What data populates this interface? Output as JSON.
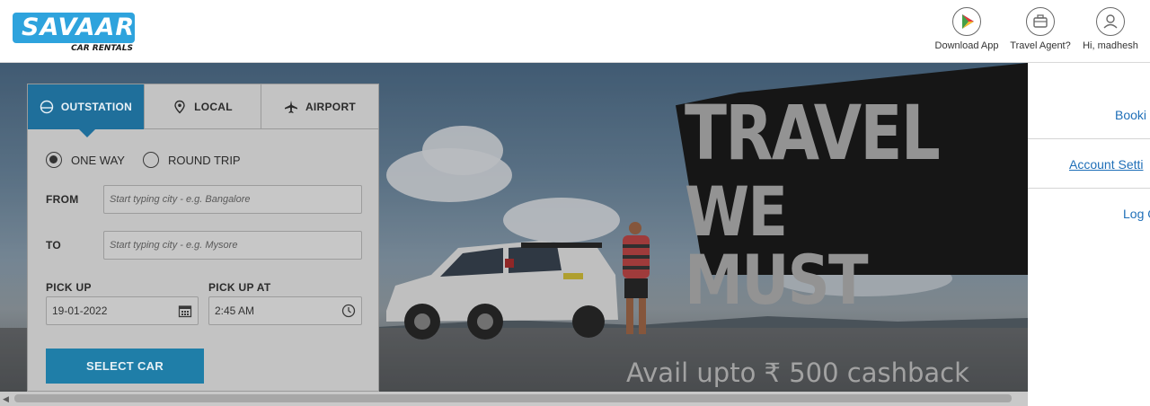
{
  "brand": {
    "name": "SAVAARI",
    "tagline": "CAR RENTALS"
  },
  "header_actions": [
    {
      "label": "Download App",
      "icon": "play-store-icon"
    },
    {
      "label": "Travel Agent?",
      "icon": "briefcase-icon"
    },
    {
      "label": "Hi, madhesh",
      "icon": "user-icon"
    }
  ],
  "hero": {
    "headline_line1": "TRAVEL",
    "headline_line2": "WE MUST",
    "offer": "Avail upto ₹ 500 cashback"
  },
  "booking": {
    "tabs": [
      {
        "label": "OUTSTATION",
        "icon": "car-front-icon",
        "active": true
      },
      {
        "label": "LOCAL",
        "icon": "location-pin-icon",
        "active": false
      },
      {
        "label": "AIRPORT",
        "icon": "airplane-icon",
        "active": false
      }
    ],
    "trip_types": [
      {
        "label": "ONE WAY",
        "selected": true
      },
      {
        "label": "ROUND TRIP",
        "selected": false
      }
    ],
    "from": {
      "label": "FROM",
      "placeholder": "Start typing city - e.g. Bangalore"
    },
    "to": {
      "label": "TO",
      "placeholder": "Start typing city - e.g. Mysore"
    },
    "pickup_date": {
      "label": "PICK UP",
      "value": "19-01-2022",
      "icon": "calendar-icon"
    },
    "pickup_time": {
      "label": "PICK UP AT",
      "value": "2:45 AM",
      "icon": "clock-icon"
    },
    "submit_label": "SELECT CAR"
  },
  "side_menu": [
    {
      "label": "Booki"
    },
    {
      "label": "Account Setti"
    },
    {
      "label": "Log O"
    }
  ],
  "colors": {
    "brand_blue": "#2ea3dd",
    "active_tab": "#1f6f9b",
    "button": "#1f7ea8",
    "link": "#1f6fb8"
  }
}
